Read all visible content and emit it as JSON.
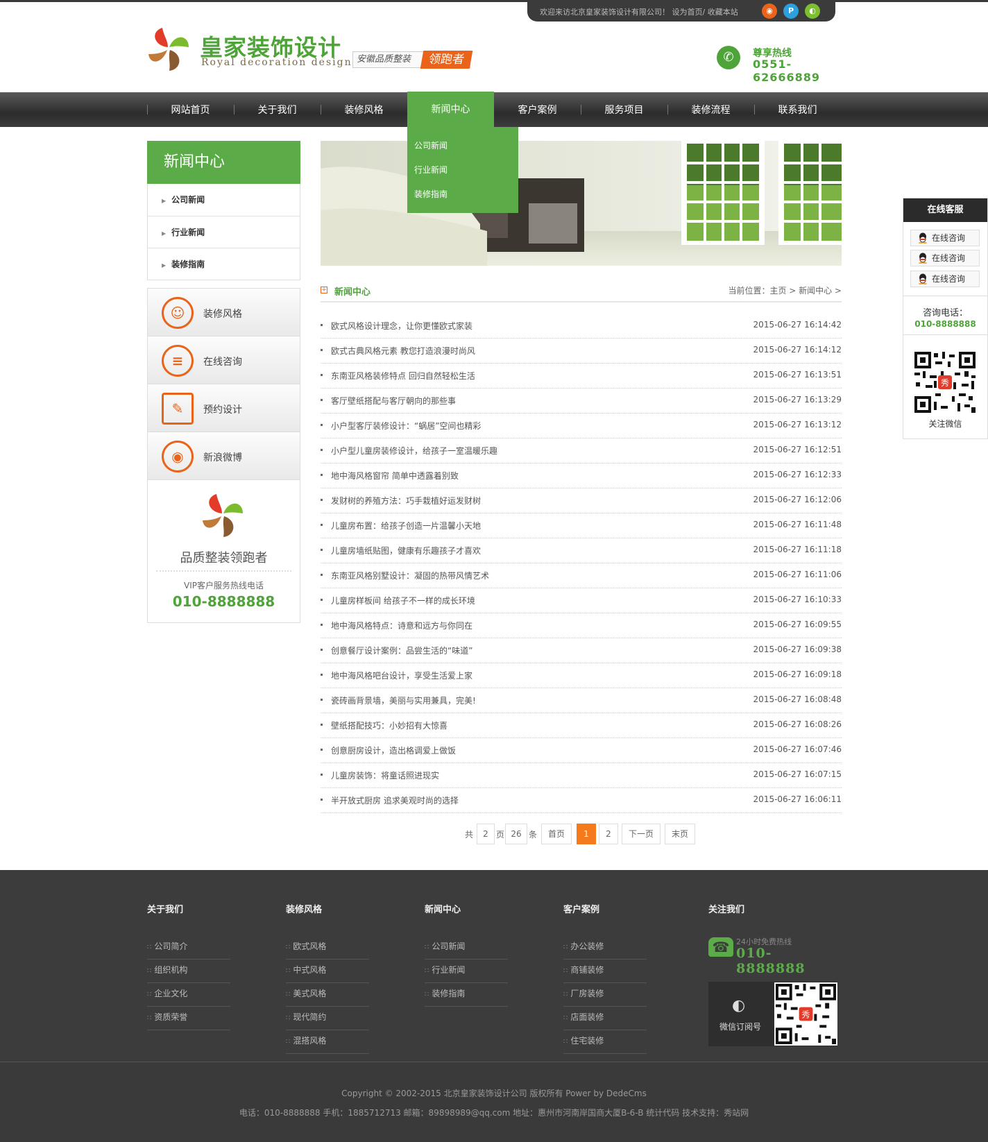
{
  "topbar": {
    "welcome": "欢迎来访北京皇家装饰设计有限公司！ 设为首页/ 收藏本站"
  },
  "logo": {
    "cn": "皇家装饰设计",
    "en": "Royal decoration design"
  },
  "slogan": {
    "text": "安徽品质整装",
    "highlight": "领跑者"
  },
  "hotline": {
    "label": "尊享热线",
    "number": "0551-62666889"
  },
  "nav": [
    {
      "label": "网站首页"
    },
    {
      "label": "关于我们"
    },
    {
      "label": "装修风格"
    },
    {
      "label": "新闻中心"
    },
    {
      "label": "客户案例"
    },
    {
      "label": "服务项目"
    },
    {
      "label": "装修流程"
    },
    {
      "label": "联系我们"
    }
  ],
  "dropdown": [
    "公司新闻",
    "行业新闻",
    "装修指南"
  ],
  "sidebar": {
    "title": "新闻中心",
    "items": [
      "公司新闻",
      "行业新闻",
      "装修指南"
    ],
    "quick": [
      "装修风格",
      "在线咨询",
      "预约设计",
      "新浪微博"
    ],
    "vip_slogan": "品质整装领跑者",
    "vip_label": "VIP客户服务热线电话",
    "vip_phone": "010-8888888"
  },
  "crumb": {
    "title": "新闻中心",
    "position": "当前位置：主页 > 新闻中心 >"
  },
  "news": [
    {
      "title": "欧式风格设计理念，让你更懂欧式家装",
      "date": "2015-06-27 16:14:42"
    },
    {
      "title": "欧式古典风格元素 教您打造浪漫时尚风",
      "date": "2015-06-27 16:14:12"
    },
    {
      "title": "东南亚风格装修特点 回归自然轻松生活",
      "date": "2015-06-27 16:13:51"
    },
    {
      "title": "客厅壁纸搭配与客厅朝向的那些事",
      "date": "2015-06-27 16:13:29"
    },
    {
      "title": "小户型客厅装修设计：“蜗居”空间也精彩",
      "date": "2015-06-27 16:13:12"
    },
    {
      "title": "小户型儿童房装修设计，给孩子一室温暖乐趣",
      "date": "2015-06-27 16:12:51"
    },
    {
      "title": "地中海风格窗帘 简单中透露着别致",
      "date": "2015-06-27 16:12:33"
    },
    {
      "title": "发财树的养殖方法：巧手栽植好运发财树",
      "date": "2015-06-27 16:12:06"
    },
    {
      "title": "儿童房布置：给孩子创造一片温馨小天地",
      "date": "2015-06-27 16:11:48"
    },
    {
      "title": "儿童房墙纸贴图，健康有乐趣孩子才喜欢",
      "date": "2015-06-27 16:11:18"
    },
    {
      "title": "东南亚风格别墅设计：凝固的热带风情艺术",
      "date": "2015-06-27 16:11:06"
    },
    {
      "title": "儿童房样板间 给孩子不一样的成长环境",
      "date": "2015-06-27 16:10:33"
    },
    {
      "title": "地中海风格特点：诗意和远方与你同在",
      "date": "2015-06-27 16:09:55"
    },
    {
      "title": "创意餐厅设计案例：品尝生活的“味道”",
      "date": "2015-06-27 16:09:38"
    },
    {
      "title": "地中海风格吧台设计，享受生活爱上家",
      "date": "2015-06-27 16:09:18"
    },
    {
      "title": "瓷砖画背景墙，美丽与实用兼具，完美!",
      "date": "2015-06-27 16:08:48"
    },
    {
      "title": "壁纸搭配技巧：小妙招有大惊喜",
      "date": "2015-06-27 16:08:26"
    },
    {
      "title": "创意厨房设计，造出格调爱上做饭",
      "date": "2015-06-27 16:07:46"
    },
    {
      "title": "儿童房装饰：将童话照进现实",
      "date": "2015-06-27 16:07:15"
    },
    {
      "title": "半开放式厨房 追求美观时尚的选择",
      "date": "2015-06-27 16:06:11"
    }
  ],
  "pager": {
    "total_prefix": "共",
    "pages": "2",
    "pages_unit": "页",
    "records": "26",
    "records_unit": "条",
    "first": "首页",
    "p1": "1",
    "p2": "2",
    "next": "下一页",
    "last": "末页"
  },
  "kefu": {
    "title": "在线客服",
    "btn": "在线咨询",
    "tel_label": "咨询电话：",
    "tel": "010-8888888",
    "wechat": "关注微信"
  },
  "footer": {
    "cols": [
      {
        "title": "关于我们",
        "links": [
          "公司简介",
          "组织机构",
          "企业文化",
          "资质荣誉"
        ]
      },
      {
        "title": "装修风格",
        "links": [
          "欧式风格",
          "中式风格",
          "美式风格",
          "现代简约",
          "混搭风格"
        ]
      },
      {
        "title": "新闻中心",
        "links": [
          "公司新闻",
          "行业新闻",
          "装修指南"
        ]
      },
      {
        "title": "客户案例",
        "links": [
          "办公装修",
          "商铺装修",
          "厂房装修",
          "店面装修",
          "住宅装修"
        ]
      }
    ],
    "follow_title": "关注我们",
    "free_label": "24小时免费热线",
    "free_phone": "010-8888888",
    "wechat_label": "微信订阅号",
    "copyright": "Copyright © 2002-2015 北京皇家装饰设计公司 版权所有 Power by DedeCms",
    "contact": "电话：010-8888888 手机：1885712713 邮箱：89898989@qq.com 地址：惠州市河南岸国商大厦B-6-B 统计代码 技术支持：秀站网"
  },
  "colors": {
    "green": "#5bac48",
    "orange": "#e9641a",
    "dark": "#3c3c3c"
  }
}
